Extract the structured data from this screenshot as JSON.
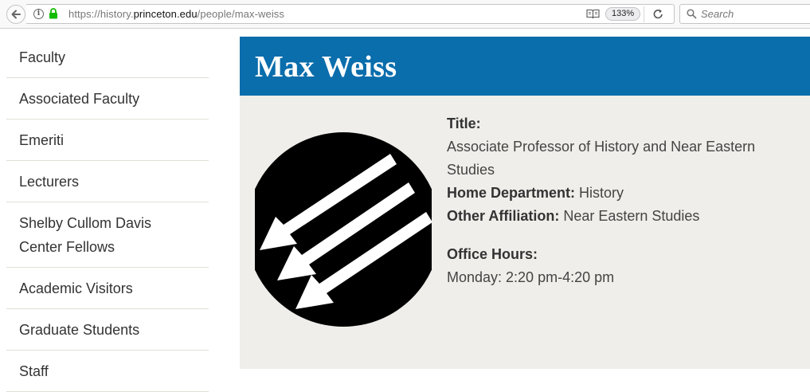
{
  "browser": {
    "url_scheme": "https://history.",
    "url_host": "princeton.edu",
    "url_path": "/people/max-weiss",
    "zoom": "133%",
    "search_placeholder": "Search"
  },
  "sidebar": {
    "items": [
      {
        "label": "Faculty"
      },
      {
        "label": "Associated Faculty"
      },
      {
        "label": "Emeriti"
      },
      {
        "label": "Lecturers"
      },
      {
        "label": "Shelby Cullom Davis Center Fellows"
      },
      {
        "label": "Academic Visitors"
      },
      {
        "label": "Graduate Students"
      },
      {
        "label": "Staff"
      }
    ]
  },
  "profile": {
    "name": "Max Weiss",
    "title_label": "Title:",
    "title_value": "Associate Professor of History and Near Eastern Studies",
    "department_label": "Home Department:",
    "department_value": "History",
    "affiliation_label": "Other Affiliation:",
    "affiliation_value": "Near Eastern Studies",
    "office_hours_label": "Office Hours:",
    "office_hours_value": "Monday: 2:20 pm-4:20 pm"
  },
  "colors": {
    "title_bar": "#0a6dac",
    "main_bg": "#efeeea",
    "avatar_bg": "#000000"
  }
}
